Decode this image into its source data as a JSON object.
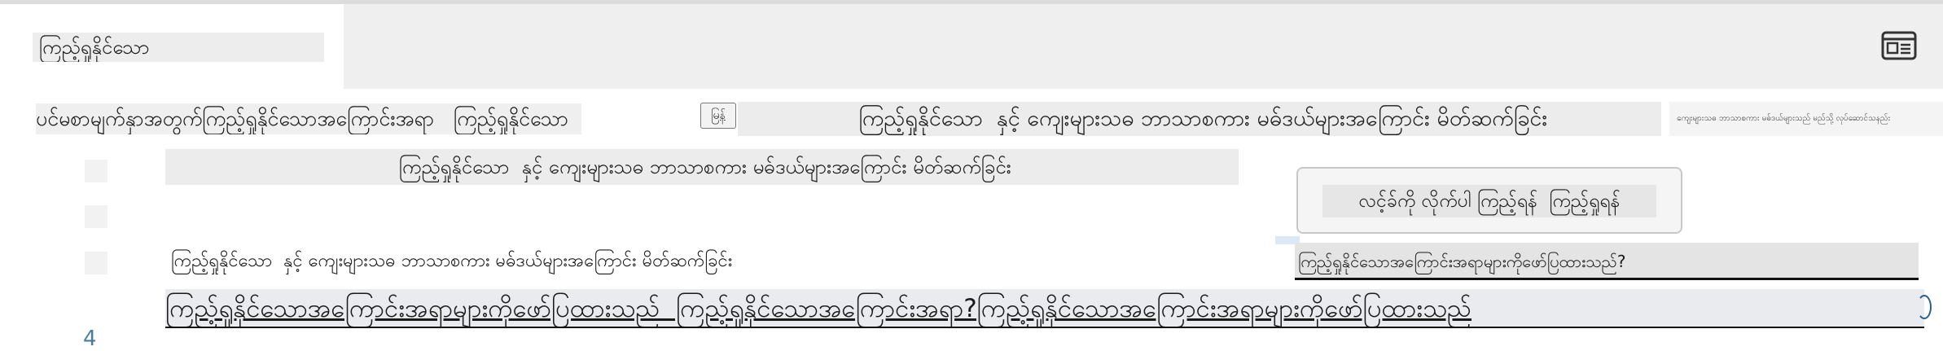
{
  "header": {
    "title": "ကြည့်ရှုနိုင်သော ​ ​"
  },
  "breadcrumb": {
    "text": "ပင်မစာမျက်နှာအတွက်ကြည့်ရှုနိုင်သောအကြောင်းအရာ ​ ​ ကြည့်ရှုနိုင်သော ​"
  },
  "lang_badge": "မြန်",
  "article": {
    "title": "​ ကြည့်ရှုနိုင်သော ​​ နှင့် ကျေးများသဓ ဘာသာစကား မဓ်ဒယ်များအကြောင်း မိတ်ဆက်ခြင်း",
    "side_snippet": "​​ ကျေးများသဓ ဘာသာစကား မဓ်ဒယ်များသည် မည်သို့ လုပ်ဆောင်သနည်း",
    "subtitle": "​ ကြည့်ရှုနိုင်သော ​​ နှင့် ကျေးများသဓ ဘာသာစကား မဓ်ဒယ်များအကြောင်း မိတ်ဆက်ခြင်း"
  },
  "steps": [
    "​",
    "​",
    "​"
  ],
  "tooltip": {
    "text": "လင့်ခ်ကို လိုက်ပါ ကြည့်ရန် ​ ကြည့်ရှုရန်"
  },
  "content": {
    "main_line": "​​ ကြည့်ရှုနိုင်သော ​​ နှင့် ကျေးများသဓ ဘာသာစကား မဓ်ဒယ်များအကြောင်း မိတ်ဆက်ခြင်း​ ​​ ",
    "main_line_tail": "ကြည့်ရှုနိုင်သောအကြောင်းအရာများကိုဖော်ပြထားသည်?​​",
    "link_line": "ကြည့်ရှုနိုင်သောအကြောင်းအရာများကိုဖော်ပြထားသည် ​ ကြည့်ရှုနိုင်သောအကြောင်းအရာ?ကြည့်ရှုနိုင်သောအကြောင်းအရာများကိုဖော်ပြထားသည်"
  },
  "page_marker": "4",
  "colors": {
    "panel_gray": "#efefef",
    "accent_blue": "#4a7c9e"
  },
  "icons": [
    "reader-view-icon"
  ]
}
